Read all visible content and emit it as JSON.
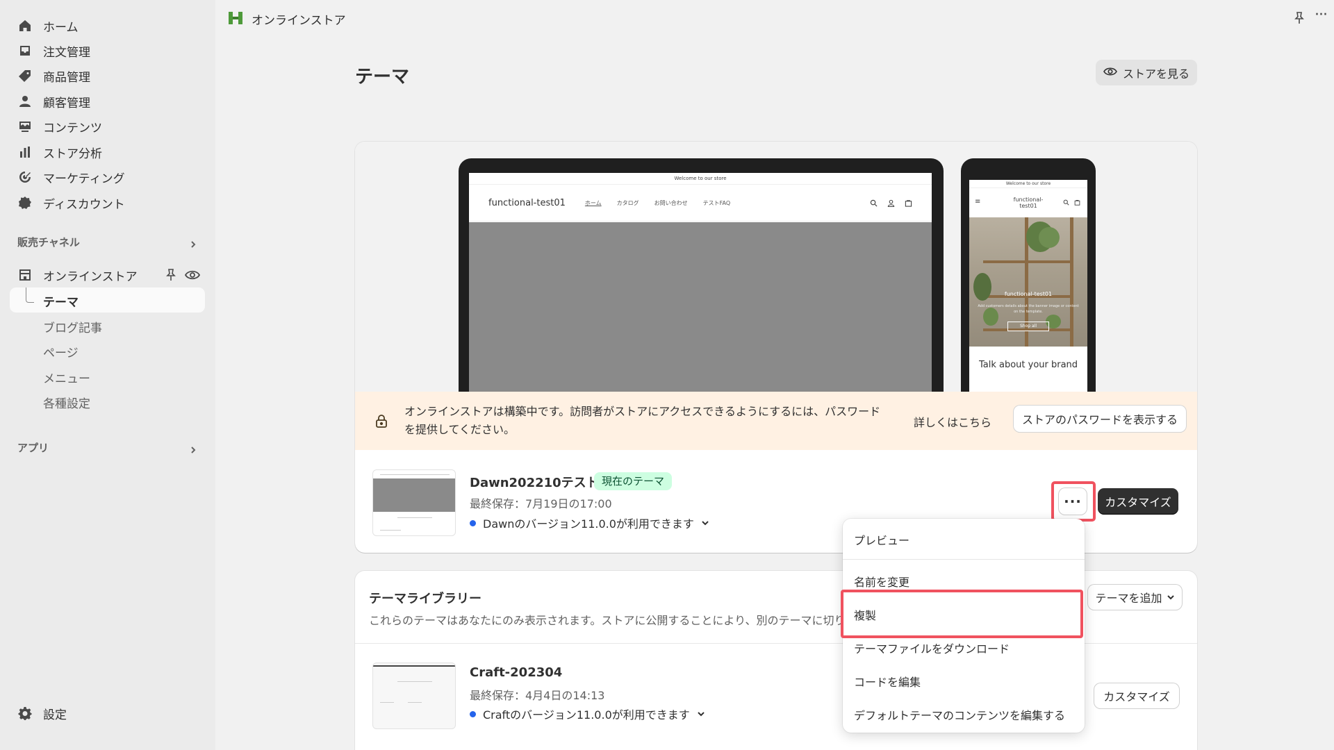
{
  "sidebar": {
    "nav": [
      {
        "label": "ホーム",
        "icon": "home-icon"
      },
      {
        "label": "注文管理",
        "icon": "inbox-icon"
      },
      {
        "label": "商品管理",
        "icon": "tag-icon"
      },
      {
        "label": "顧客管理",
        "icon": "person-icon"
      },
      {
        "label": "コンテンツ",
        "icon": "content-icon"
      },
      {
        "label": "ストア分析",
        "icon": "bar-chart-icon"
      },
      {
        "label": "マーケティング",
        "icon": "target-icon"
      },
      {
        "label": "ディスカウント",
        "icon": "discount-icon"
      }
    ],
    "sales_channels_label": "販売チャネル",
    "online_store_label": "オンラインストア",
    "sub_items": [
      "テーマ",
      "ブログ記事",
      "ページ",
      "メニュー",
      "各種設定"
    ],
    "apps_label": "アプリ",
    "settings_label": "設定"
  },
  "topbar": {
    "store_label": "オンラインストア"
  },
  "page": {
    "title": "テーマ",
    "view_store_label": "ストアを見る"
  },
  "preview": {
    "laptop": {
      "announcement": "Welcome to our store",
      "brand": "functional-test01",
      "nav_links": [
        "ホーム",
        "カタログ",
        "お問い合わせ",
        "テストFAQ"
      ]
    },
    "phone": {
      "announcement": "Welcome to our store",
      "brand": "functional-test01",
      "hero_title": "functional-test01",
      "hero_sub": "Add customers details about the banner image or content on the template.",
      "hero_button": "Shop all",
      "talk": "Talk about your brand"
    }
  },
  "notice": {
    "text": "オンラインストアは構築中です。訪問者がストアにアクセスできるようにするには、パスワードを提供してください。",
    "learn_more": "詳しくはこちら",
    "show_password_button": "ストアのパスワードを表示する",
    "background_color": "#fff1e3"
  },
  "current_theme": {
    "name": "Dawn202210テスト",
    "badge": "現在のテーマ",
    "last_saved": "最終保存：7月19日の17:00",
    "update_notice": "Dawnのバージョン11.0.0が利用できます",
    "customize_label": "カスタマイズ"
  },
  "library": {
    "title": "テーマライブラリー",
    "description": "これらのテーマはあなたにのみ表示されます。ストアに公開することにより、別のテーマに切り替えることができます。",
    "add_theme_label": "テーマを追加",
    "themes": [
      {
        "name": "Craft-202304",
        "last_saved": "最終保存：4月4日の14:13",
        "update_notice": "Craftのバージョン11.0.0が利用できます",
        "customize_label": "カスタマイズ"
      }
    ]
  },
  "menu": {
    "items": [
      "プレビュー",
      "名前を変更",
      "複製",
      "テーマファイルをダウンロード",
      "コードを編集",
      "デフォルトテーマのコンテンツを編集する"
    ]
  },
  "colors": {
    "highlight": "#f0525f",
    "badge_bg": "#cdfee1",
    "update_dot": "#2463eb",
    "primary_button": "#303030"
  }
}
